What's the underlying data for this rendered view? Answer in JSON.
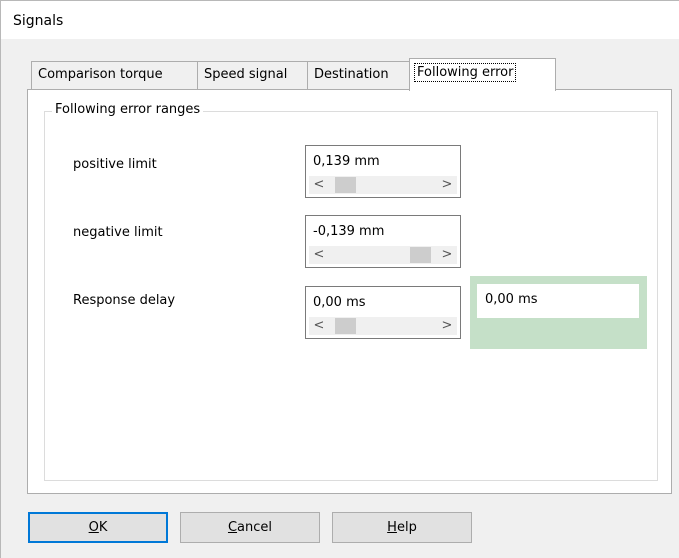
{
  "window": {
    "title": "Signals"
  },
  "tabs": [
    {
      "label": "Comparison torque"
    },
    {
      "label": "Speed signal"
    },
    {
      "label": "Destination"
    },
    {
      "label": "Following error"
    }
  ],
  "group": {
    "title": "Following error ranges"
  },
  "fields": {
    "positive": {
      "label": "positive limit",
      "value": "0,139 mm",
      "slider_level": 0.08
    },
    "negative": {
      "label": "negative limit",
      "value": "-0,139 mm",
      "slider_level": 0.92
    },
    "delay": {
      "label": "Response delay",
      "value": "0,00 ms",
      "slider_level": 0.08
    }
  },
  "readout": {
    "value": "0,00 ms",
    "panel_color": "#c5e0c8"
  },
  "scroll_arrows": {
    "left": "<",
    "right": ">"
  },
  "buttons": {
    "ok": {
      "accel": "O",
      "rest": "K"
    },
    "cancel": {
      "accel": "C",
      "rest": "ancel"
    },
    "help": {
      "accel": "H",
      "rest": "elp"
    }
  }
}
